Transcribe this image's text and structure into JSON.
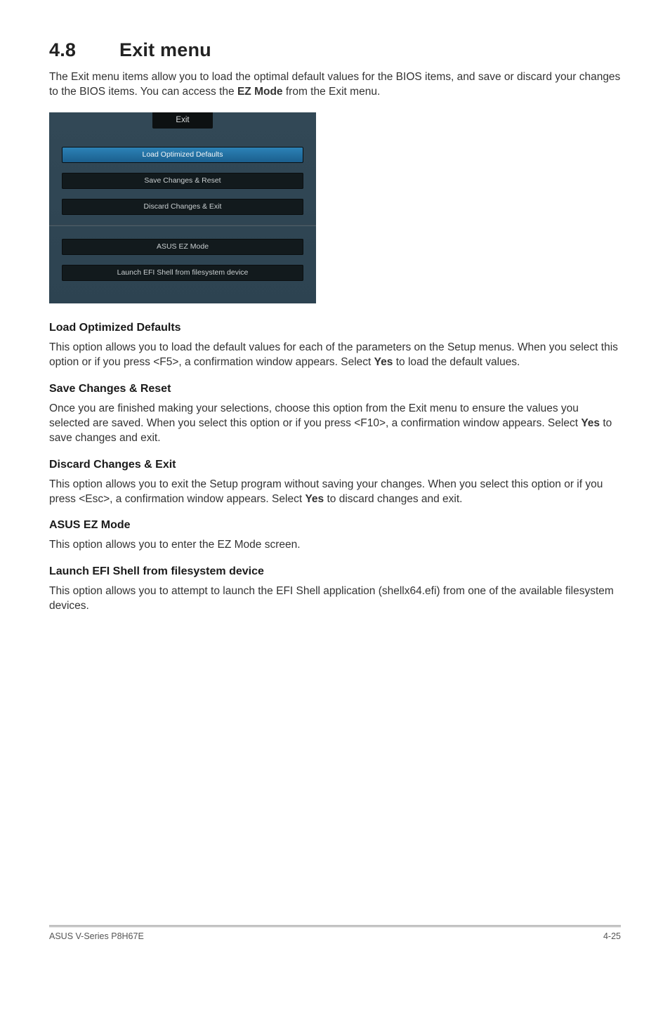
{
  "section": {
    "number": "4.8",
    "title": "Exit menu"
  },
  "intro": {
    "t1": "The Exit menu items allow you to load the optimal default values for the BIOS items, and save or discard your changes to the BIOS items. You can access the ",
    "ez": "EZ Mode",
    "t2": " from the Exit menu."
  },
  "bios": {
    "tab": "Exit",
    "b1": "Load Optimized Defaults",
    "b2": "Save Changes & Reset",
    "b3": "Discard Changes & Exit",
    "b4": "ASUS EZ Mode",
    "b5": "Launch EFI Shell from filesystem device"
  },
  "s_load": {
    "h": "Load Optimized Defaults",
    "t1": "This option allows you to load the default values for each of the parameters on the Setup menus. When you select this option or if you press <F5>, a confirmation window appears. Select ",
    "yes": "Yes",
    "t2": " to load the default values."
  },
  "s_save": {
    "h": "Save Changes & Reset",
    "t1": "Once you are finished making your selections, choose this option from the Exit menu to ensure the values you selected are saved. When you select this option or if you press <F10>, a confirmation window appears. Select ",
    "yes": "Yes",
    "t2": " to save changes and exit."
  },
  "s_discard": {
    "h": "Discard Changes & Exit",
    "t1": "This option allows you to exit the Setup program without saving your changes. When you select this option or if you press <Esc>, a confirmation window appears. Select ",
    "yes": "Yes",
    "t2": " to discard changes and exit."
  },
  "s_ez": {
    "h": "ASUS EZ Mode",
    "t": "This option allows you to enter the EZ Mode screen."
  },
  "s_efi": {
    "h": "Launch EFI Shell from filesystem device",
    "t": "This option allows you to attempt to launch the EFI Shell application (shellx64.efi) from one of the available filesystem devices."
  },
  "footer": {
    "left": "ASUS V-Series P8H67E",
    "right": "4-25"
  }
}
